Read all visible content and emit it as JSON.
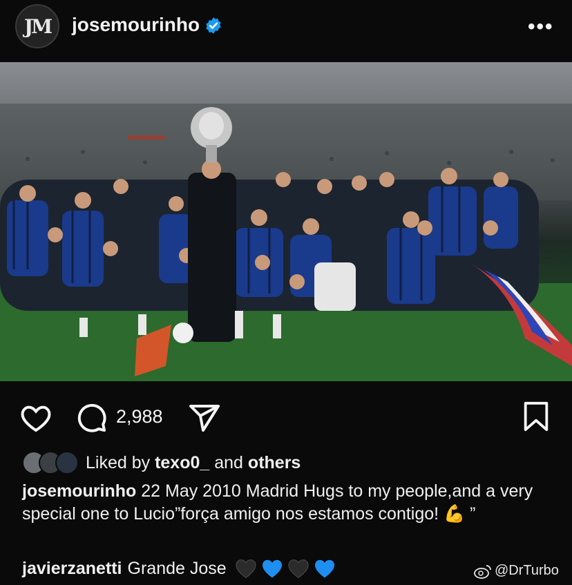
{
  "header": {
    "avatar_text": "JM",
    "username": "josemourinho",
    "more_label": "•••",
    "verified_icon": "verified-badge-icon",
    "verified_color": "#1d9bf0"
  },
  "post": {
    "comment_count": "2,988",
    "liked_by_prefix": "Liked by",
    "liked_by_user": "texo0_",
    "liked_by_and": "and",
    "liked_by_others": "others"
  },
  "caption": {
    "author": "josemourinho",
    "text": "22 May 2010 Madrid  Hugs to my people,and a very special one to Lucio”força amigo nos estamos contigo! 💪 ”"
  },
  "comment": {
    "author": "javierzanetti",
    "text": "Grande Jose"
  },
  "watermark": {
    "text": "@DrTurbo"
  },
  "colors": {
    "background": "#0a0a0a",
    "text": "#f5f5f5",
    "heart_blue": "#1e8ef0",
    "heart_black": "#2b2b2b"
  }
}
